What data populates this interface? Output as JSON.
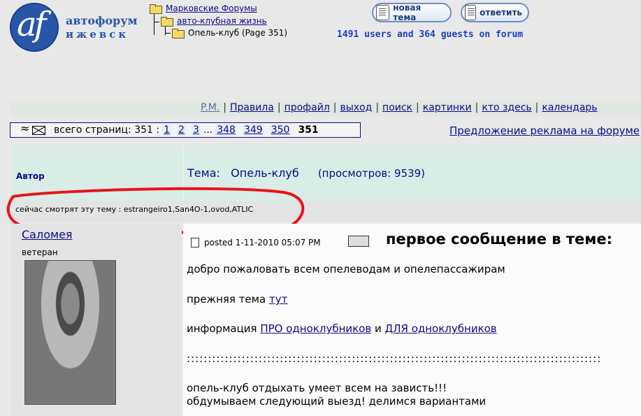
{
  "logo": {
    "mark": "af",
    "line1": "автофорум",
    "line2": "ижевск"
  },
  "breadcrumb": [
    {
      "label": "Марковские Форумы"
    },
    {
      "label": "авто-клубная жизнь"
    },
    {
      "label": "Опель-клуб (Page 351)"
    }
  ],
  "buttons": {
    "new_topic": "новая тема",
    "reply": "ответить"
  },
  "online_text": "1491 users and 364 guests on forum",
  "nav": [
    "P.M.",
    "Правила",
    "профайл",
    "выход",
    "поиск",
    "картинки",
    "кто здесь",
    "календарь"
  ],
  "pager": {
    "label": "всего страниц:",
    "total": "351",
    "colon": ":",
    "pages": [
      "1",
      "2",
      "3"
    ],
    "ellipsis": "...",
    "pages_end": [
      "348",
      "349",
      "350"
    ],
    "current": "351"
  },
  "ad_link": "Предложение реклама на форуме",
  "table_header": {
    "author": "Автор",
    "topic_label": "Тема:",
    "topic_name": "Опель-клуб",
    "views": "(просмотров: 9539)"
  },
  "viewers_text": "сейчас смотрят эту тему : estrangeiro1,San4O-1,ovod,ATLIC",
  "post": {
    "author": "Саломея",
    "rank": "ветеран",
    "meta": "posted 1-11-2010 05:07 PM",
    "title": "первое сообщение в теме:",
    "line1": "добро пожаловать всем опелеводам и опелепассажирам",
    "line2_prefix": "прежняя тема",
    "line2_link": "тут",
    "line3_prefix": "информация",
    "line3_link1": "ПРО одноклубников",
    "line3_mid": "и",
    "line3_link2": "ДЛЯ одноклубников",
    "divider": "::::::::::::::::::::::::::::::::::::::::::::::::::::::::::::::::::::::::::::::::::::::::::::::::::",
    "line4": "опель-клуб отдыхать умеет всем на зависть!!!",
    "line5": "обдумываем следующий выезд! делимся вариантами"
  },
  "colors": {
    "link": "#0b0b8a",
    "online": "#1d3fc0",
    "header_bg": "#d9ece6",
    "highlight_circle": "#e8141a"
  }
}
